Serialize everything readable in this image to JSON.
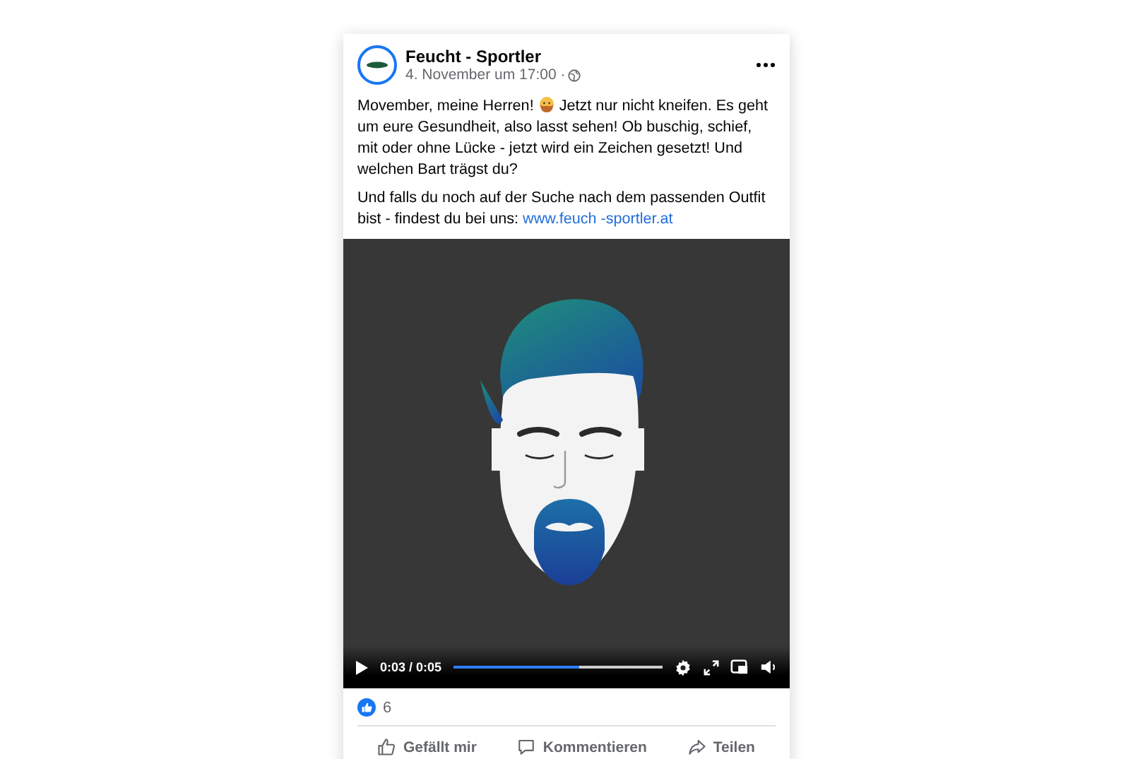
{
  "post": {
    "author": "Feucht - Sportler",
    "timestamp": "4. November um 17:00 ·",
    "intro": {
      "before_emoji": "Movember, meine Herren!",
      "after_emoji": "Jetzt nur nicht kneifen. Es geht um eure Gesundheit, also lasst sehen! Ob buschig, schief, mit oder ohne Lücke - jetzt wird ein Zeichen gesetzt! Und welchen Bart trägst du?"
    },
    "closing": {
      "text": "Und falls du noch auf der Suche nach dem passenden Outfit bist - findest du bei uns:",
      "link": "www.feuch -sportler.at"
    },
    "video": {
      "time": "0:03 / 0:05",
      "level": 0.6
    },
    "like_count": "6",
    "actions": [
      {
        "kind": "like",
        "label": "Gefällt mir"
      },
      {
        "kind": "comment",
        "label": "Kommentieren"
      },
      {
        "kind": "share",
        "label": "Teilen"
      }
    ]
  }
}
